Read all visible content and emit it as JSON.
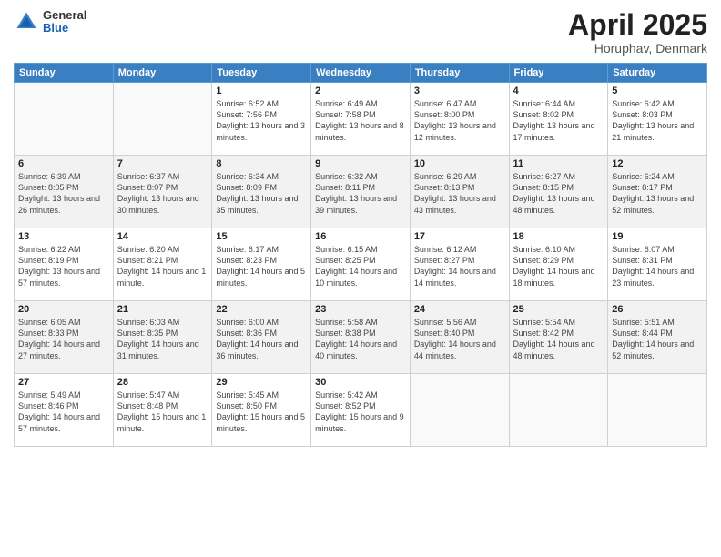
{
  "logo": {
    "general": "General",
    "blue": "Blue"
  },
  "title": {
    "month": "April 2025",
    "location": "Horuphav, Denmark"
  },
  "days_header": [
    "Sunday",
    "Monday",
    "Tuesday",
    "Wednesday",
    "Thursday",
    "Friday",
    "Saturday"
  ],
  "weeks": [
    [
      {
        "day": "",
        "info": ""
      },
      {
        "day": "",
        "info": ""
      },
      {
        "day": "1",
        "info": "Sunrise: 6:52 AM\nSunset: 7:56 PM\nDaylight: 13 hours and 3 minutes."
      },
      {
        "day": "2",
        "info": "Sunrise: 6:49 AM\nSunset: 7:58 PM\nDaylight: 13 hours and 8 minutes."
      },
      {
        "day": "3",
        "info": "Sunrise: 6:47 AM\nSunset: 8:00 PM\nDaylight: 13 hours and 12 minutes."
      },
      {
        "day": "4",
        "info": "Sunrise: 6:44 AM\nSunset: 8:02 PM\nDaylight: 13 hours and 17 minutes."
      },
      {
        "day": "5",
        "info": "Sunrise: 6:42 AM\nSunset: 8:03 PM\nDaylight: 13 hours and 21 minutes."
      }
    ],
    [
      {
        "day": "6",
        "info": "Sunrise: 6:39 AM\nSunset: 8:05 PM\nDaylight: 13 hours and 26 minutes."
      },
      {
        "day": "7",
        "info": "Sunrise: 6:37 AM\nSunset: 8:07 PM\nDaylight: 13 hours and 30 minutes."
      },
      {
        "day": "8",
        "info": "Sunrise: 6:34 AM\nSunset: 8:09 PM\nDaylight: 13 hours and 35 minutes."
      },
      {
        "day": "9",
        "info": "Sunrise: 6:32 AM\nSunset: 8:11 PM\nDaylight: 13 hours and 39 minutes."
      },
      {
        "day": "10",
        "info": "Sunrise: 6:29 AM\nSunset: 8:13 PM\nDaylight: 13 hours and 43 minutes."
      },
      {
        "day": "11",
        "info": "Sunrise: 6:27 AM\nSunset: 8:15 PM\nDaylight: 13 hours and 48 minutes."
      },
      {
        "day": "12",
        "info": "Sunrise: 6:24 AM\nSunset: 8:17 PM\nDaylight: 13 hours and 52 minutes."
      }
    ],
    [
      {
        "day": "13",
        "info": "Sunrise: 6:22 AM\nSunset: 8:19 PM\nDaylight: 13 hours and 57 minutes."
      },
      {
        "day": "14",
        "info": "Sunrise: 6:20 AM\nSunset: 8:21 PM\nDaylight: 14 hours and 1 minute."
      },
      {
        "day": "15",
        "info": "Sunrise: 6:17 AM\nSunset: 8:23 PM\nDaylight: 14 hours and 5 minutes."
      },
      {
        "day": "16",
        "info": "Sunrise: 6:15 AM\nSunset: 8:25 PM\nDaylight: 14 hours and 10 minutes."
      },
      {
        "day": "17",
        "info": "Sunrise: 6:12 AM\nSunset: 8:27 PM\nDaylight: 14 hours and 14 minutes."
      },
      {
        "day": "18",
        "info": "Sunrise: 6:10 AM\nSunset: 8:29 PM\nDaylight: 14 hours and 18 minutes."
      },
      {
        "day": "19",
        "info": "Sunrise: 6:07 AM\nSunset: 8:31 PM\nDaylight: 14 hours and 23 minutes."
      }
    ],
    [
      {
        "day": "20",
        "info": "Sunrise: 6:05 AM\nSunset: 8:33 PM\nDaylight: 14 hours and 27 minutes."
      },
      {
        "day": "21",
        "info": "Sunrise: 6:03 AM\nSunset: 8:35 PM\nDaylight: 14 hours and 31 minutes."
      },
      {
        "day": "22",
        "info": "Sunrise: 6:00 AM\nSunset: 8:36 PM\nDaylight: 14 hours and 36 minutes."
      },
      {
        "day": "23",
        "info": "Sunrise: 5:58 AM\nSunset: 8:38 PM\nDaylight: 14 hours and 40 minutes."
      },
      {
        "day": "24",
        "info": "Sunrise: 5:56 AM\nSunset: 8:40 PM\nDaylight: 14 hours and 44 minutes."
      },
      {
        "day": "25",
        "info": "Sunrise: 5:54 AM\nSunset: 8:42 PM\nDaylight: 14 hours and 48 minutes."
      },
      {
        "day": "26",
        "info": "Sunrise: 5:51 AM\nSunset: 8:44 PM\nDaylight: 14 hours and 52 minutes."
      }
    ],
    [
      {
        "day": "27",
        "info": "Sunrise: 5:49 AM\nSunset: 8:46 PM\nDaylight: 14 hours and 57 minutes."
      },
      {
        "day": "28",
        "info": "Sunrise: 5:47 AM\nSunset: 8:48 PM\nDaylight: 15 hours and 1 minute."
      },
      {
        "day": "29",
        "info": "Sunrise: 5:45 AM\nSunset: 8:50 PM\nDaylight: 15 hours and 5 minutes."
      },
      {
        "day": "30",
        "info": "Sunrise: 5:42 AM\nSunset: 8:52 PM\nDaylight: 15 hours and 9 minutes."
      },
      {
        "day": "",
        "info": ""
      },
      {
        "day": "",
        "info": ""
      },
      {
        "day": "",
        "info": ""
      }
    ]
  ]
}
